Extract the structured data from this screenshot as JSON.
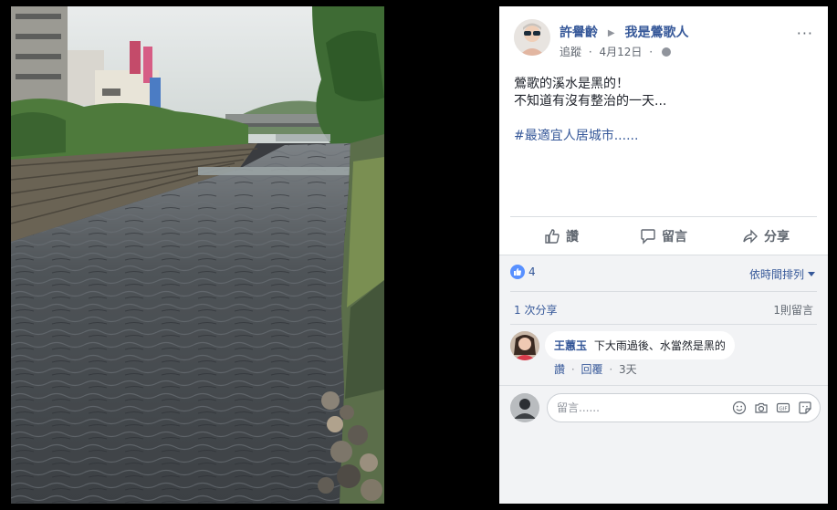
{
  "post": {
    "author": "許譽齡",
    "arrow": "▶",
    "group": "我是鶯歌人",
    "follow": "追蹤",
    "date": "4月12日",
    "text_line1": "鶯歌的溪水是黑的！",
    "text_line2": "不知道有沒有整治的一天...",
    "hashtag": "#最適宜人居城市......",
    "more": "···"
  },
  "actions": {
    "like": "讚",
    "comment": "留言",
    "share": "分享"
  },
  "feedback": {
    "like_count": "4",
    "sort_label": "依時間排列",
    "shares": "1 次分享",
    "comments_count": "1則留言"
  },
  "comment": {
    "author": "王蕙玉",
    "text": "下大雨過後、水當然是黑的",
    "like": "讚",
    "sep": "·",
    "reply": "回覆",
    "time": "3天"
  },
  "composer": {
    "placeholder": "留言......"
  },
  "icons": [
    "emoji-icon",
    "camera-icon",
    "gif-icon",
    "sticker-icon",
    "thumbs-up-icon",
    "comment-bubble-icon",
    "share-arrow-icon",
    "globe-icon"
  ],
  "colors": {
    "link": "#365899",
    "like_blue": "#5890ff",
    "background": "#000000"
  }
}
